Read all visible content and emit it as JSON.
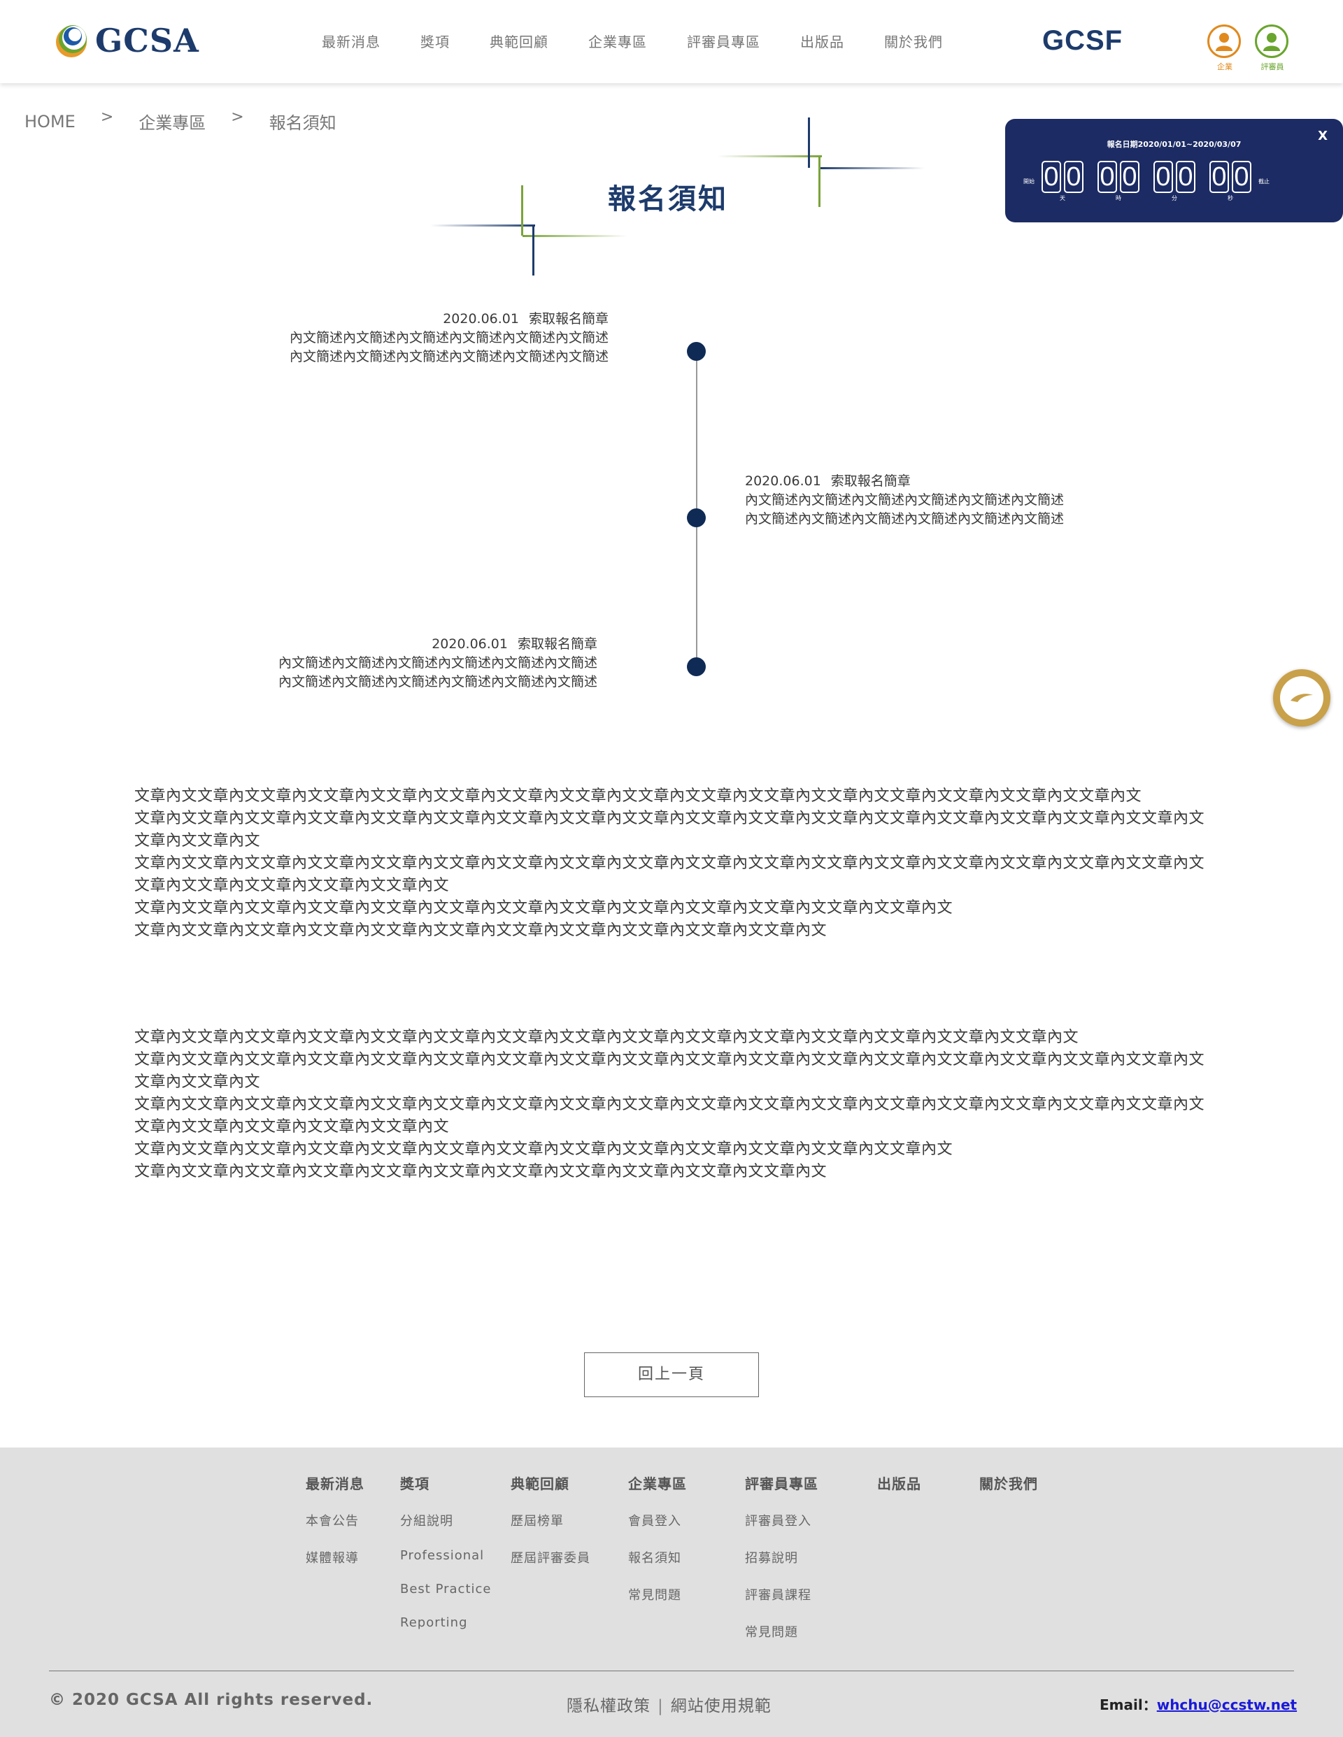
{
  "header": {
    "logo_text": "GCSA",
    "nav": [
      "最新消息",
      "獎項",
      "典範回顧",
      "企業專區",
      "評審員專區",
      "出版品",
      "關於我們"
    ],
    "gcsf": "GCSF",
    "user_buttons": [
      {
        "label": "企業",
        "color": "#e08a1e"
      },
      {
        "label": "評審員",
        "color": "#6aa52e"
      }
    ]
  },
  "breadcrumb": {
    "home": "HOME",
    "sep": ">",
    "level1": "企業專區",
    "level2": "報名須知"
  },
  "page_title": "報名須知",
  "countdown": {
    "close": "X",
    "period": "報名日期2020/01/01~2020/03/07",
    "start_label": "開始",
    "end_label": "截止",
    "groups": [
      {
        "digits": [
          "0",
          "0"
        ],
        "unit": "天"
      },
      {
        "digits": [
          "0",
          "0"
        ],
        "unit": "時"
      },
      {
        "digits": [
          "0",
          "0"
        ],
        "unit": "分"
      },
      {
        "digits": [
          "0",
          "0"
        ],
        "unit": "秒"
      }
    ]
  },
  "timeline": [
    {
      "date": "2020.06.01",
      "title": "索取報名簡章",
      "lines": [
        "內文簡述內文簡述內文簡述內文簡述內文簡述內文簡述",
        "內文簡述內文簡述內文簡述內文簡述內文簡述內文簡述"
      ]
    },
    {
      "date": "2020.06.01",
      "title": "索取報名簡章",
      "lines": [
        "內文簡述內文簡述內文簡述內文簡述內文簡述內文簡述",
        "內文簡述內文簡述內文簡述內文簡述內文簡述內文簡述"
      ]
    },
    {
      "date": "2020.06.01",
      "title": "索取報名簡章",
      "lines": [
        "內文簡述內文簡述內文簡述內文簡述內文簡述內文簡述",
        "內文簡述內文簡述內文簡述內文簡述內文簡述內文簡述"
      ]
    }
  ],
  "articles": [
    {
      "lines": [
        "文章內文文章內文文章內文文章內文文章內文文章內文文章內文文章內文文章內文文章內文文章內文文章內文文章內文文章內文文章內文文章內文",
        "文章內文文章內文文章內文文章內文文章內文文章內文文章內文文章內文文章內文文章內文文章內文文章內文文章內文文章內文文章內文文章內文文章內文文章內文文章內文",
        "文章內文文章內文文章內文文章內文文章內文文章內文文章內文文章內文文章內文文章內文文章內文文章內文文章內文文章內文文章內文文章內文文章內文文章內文文章內文文章內文文章內文文章內文",
        "文章內文文章內文文章內文文章內文文章內文文章內文文章內文文章內文文章內文文章內文文章內文文章內文文章內文",
        "文章內文文章內文文章內文文章內文文章內文文章內文文章內文文章內文文章內文文章內文文章內文"
      ]
    },
    {
      "lines": [
        "文章內文文章內文文章內文文章內文文章內文文章內文文章內文文章內文文章內文文章內文文章內文文章內文文章內文文章內文文章內文",
        "文章內文文章內文文章內文文章內文文章內文文章內文文章內文文章內文文章內文文章內文文章內文文章內文文章內文文章內文文章內文文章內文文章內文文章內文文章內文",
        "文章內文文章內文文章內文文章內文文章內文文章內文文章內文文章內文文章內文文章內文文章內文文章內文文章內文文章內文文章內文文章內文文章內文文章內文文章內文文章內文文章內文文章內文",
        "文章內文文章內文文章內文文章內文文章內文文章內文文章內文文章內文文章內文文章內文文章內文文章內文文章內文",
        "文章內文文章內文文章內文文章內文文章內文文章內文文章內文文章內文文章內文文章內文文章內文"
      ]
    }
  ],
  "back_button": "回上一頁",
  "footer": {
    "columns": [
      {
        "heading": "最新消息",
        "links": [
          "本會公告",
          "媒體報導"
        ]
      },
      {
        "heading": "獎項",
        "links": [
          "分組說明",
          "Professional",
          "Best Practice",
          "Reporting"
        ]
      },
      {
        "heading": "典範回顧",
        "links": [
          "歷屆榜單",
          "歷屆評審委員"
        ]
      },
      {
        "heading": "企業專區",
        "links": [
          "會員登入",
          "報名須知",
          "常見問題"
        ]
      },
      {
        "heading": "評審員專區",
        "links": [
          "評審員登入",
          "招募說明",
          "評審員課程",
          "常見問題"
        ]
      },
      {
        "heading": "出版品",
        "links": []
      },
      {
        "heading": "關於我們",
        "links": []
      }
    ],
    "copyright": "© 2020 GCSA All rights reserved.",
    "privacy": "隱私權政策",
    "terms": "網站使用規範",
    "email_label": "Email：",
    "email": "whchu@ccstw.net"
  },
  "colors": {
    "navy": "#1d3b6c",
    "accent_green": "#7aa33a",
    "countdown_bg": "#1c2b63",
    "footer_bg": "#e0e0e0"
  }
}
